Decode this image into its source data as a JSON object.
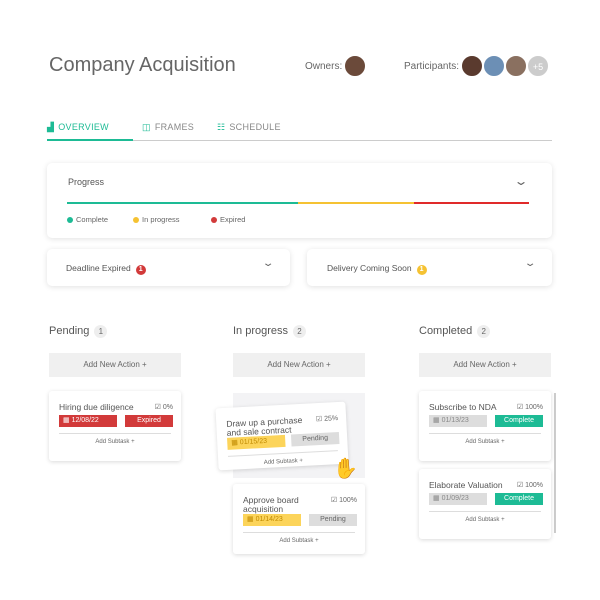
{
  "header": {
    "title": "Company Acquisition",
    "owners_label": "Owners:",
    "participants_label": "Participants:",
    "participants_more": "+5"
  },
  "tabs": [
    {
      "label": "OVERVIEW",
      "icon": "bar-chart-icon",
      "active": true
    },
    {
      "label": "FRAMES",
      "icon": "frames-icon"
    },
    {
      "label": "SCHEDULE",
      "icon": "schedule-icon"
    }
  ],
  "progress": {
    "title": "Progress",
    "complete_pct": 50,
    "in_progress_pct": 25,
    "expired_pct": 25,
    "legend": [
      "Complete",
      "In progress",
      "Expired"
    ],
    "colors": {
      "complete": "#1dbb95",
      "in_progress": "#f5c232",
      "expired": "#e02a2a"
    }
  },
  "alerts": [
    {
      "label": "Deadline Expired",
      "count": "1",
      "color": "#d23a3a"
    },
    {
      "label": "Delivery Coming Soon",
      "count": "1",
      "color": "#f5c232"
    }
  ],
  "columns": [
    {
      "title": "Pending",
      "count": "1",
      "add": "Add New Action +",
      "tasks": [
        {
          "name": "Hiring due diligence",
          "pct": "0%",
          "date": "12/08/22",
          "status": "Expired",
          "sub": "Add Subtask +"
        }
      ]
    },
    {
      "title": "In progress",
      "count": "2",
      "add": "Add New Action +",
      "tasks": [
        {
          "name": "Draw up a purchase and sale contract",
          "pct": "25%",
          "date": "01/15/23",
          "status": "Pending",
          "sub": "Add Subtask +"
        },
        {
          "name": "Approve board acquisition",
          "pct": "100%",
          "date": "01/14/23",
          "status": "Pending",
          "sub": "Add Subtask +"
        }
      ]
    },
    {
      "title": "Completed",
      "count": "2",
      "add": "Add New Action +",
      "tasks": [
        {
          "name": "Subscribe to NDA",
          "pct": "100%",
          "date": "01/13/23",
          "status": "Complete",
          "sub": "Add Subtask +"
        },
        {
          "name": "Elaborate Valuation",
          "pct": "100%",
          "date": "01/09/23",
          "status": "Complete",
          "sub": "Add Subtask +"
        }
      ]
    }
  ]
}
